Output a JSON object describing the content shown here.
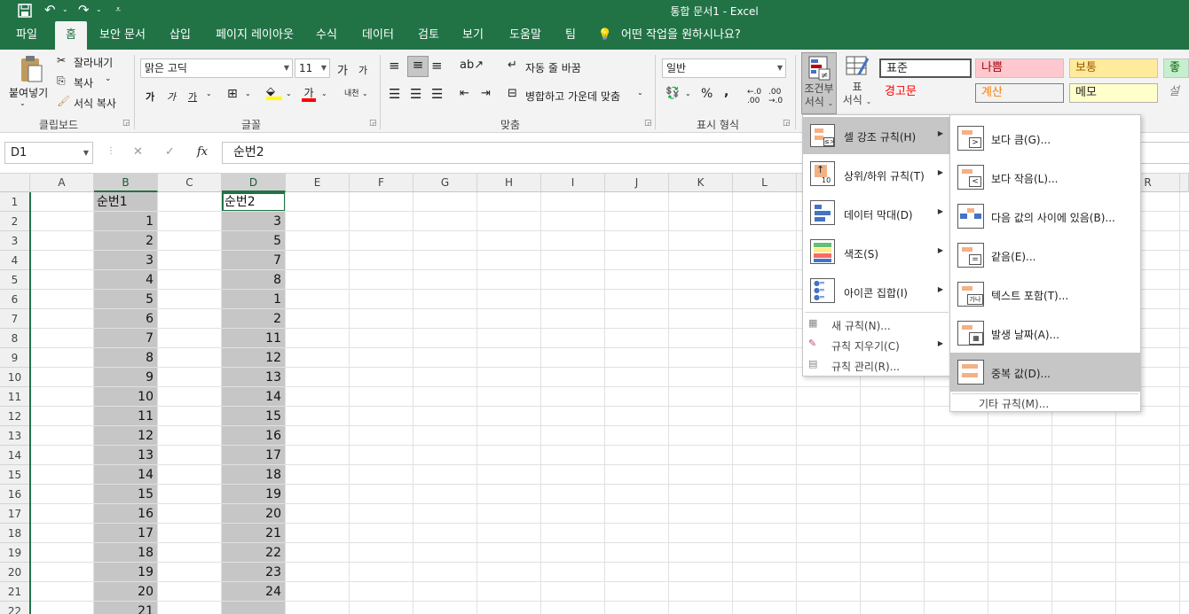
{
  "window": {
    "title": "통합 문서1  -  Excel"
  },
  "quick_access": {
    "save_icon": "save-icon",
    "undo_icon": "undo-icon",
    "redo_icon": "redo-icon",
    "customize_icon": "customize-icon"
  },
  "tabs": [
    {
      "label": "파일"
    },
    {
      "label": "홈"
    },
    {
      "label": "보안 문서"
    },
    {
      "label": "삽입"
    },
    {
      "label": "페이지 레이아웃"
    },
    {
      "label": "수식"
    },
    {
      "label": "데이터"
    },
    {
      "label": "검토"
    },
    {
      "label": "보기"
    },
    {
      "label": "도움말"
    },
    {
      "label": "팀"
    }
  ],
  "tell_me": "어떤 작업을 원하시나요?",
  "clipboard": {
    "paste": "붙여넣기",
    "cut": "잘라내기",
    "copy": "복사",
    "format_painter": "서식 복사",
    "label": "클립보드"
  },
  "font": {
    "name": "맑은 고딕",
    "size": "11",
    "grow": "가",
    "shrink": "가",
    "bold": "가",
    "italic": "가",
    "underline": "가",
    "font_color": "가",
    "phonetic": "내천",
    "label": "글꼴"
  },
  "alignment": {
    "wrap_text": "자동 줄 바꿈",
    "merge_center": "병합하고 가운데 맞춤",
    "label": "맞춤"
  },
  "number": {
    "format": "일반",
    "percent": "%",
    "comma": ",",
    "label": "표시 형식"
  },
  "styles": {
    "conditional": "조건부 서식",
    "conditional_l1": "조건부",
    "conditional_l2": "서식",
    "table_l1": "표",
    "table_l2": "서식",
    "cells": [
      {
        "label": "표준"
      },
      {
        "label": "나쁨"
      },
      {
        "label": "보통"
      },
      {
        "label": "좋음"
      },
      {
        "label": "경고문"
      },
      {
        "label": "계산"
      },
      {
        "label": "메모"
      },
      {
        "label": "설명"
      }
    ],
    "colors": {
      "bad_bg": "#ffc7ce",
      "bad_fg": "#9c0006",
      "neutral_bg": "#ffeb9c",
      "neutral_fg": "#9c5700",
      "good_bg": "#c6efce",
      "good_fg": "#006100",
      "warn_fg": "#ff0000",
      "calc_fg": "#fa7d00",
      "note_bg": "#ffffcc"
    }
  },
  "formula_bar": {
    "name_box": "D1",
    "cancel": "✕",
    "enter": "✓",
    "fx": "fx",
    "value": "순번2"
  },
  "sheet": {
    "columns": [
      "A",
      "B",
      "C",
      "D",
      "E",
      "F",
      "G",
      "H",
      "I",
      "J",
      "K",
      "L",
      "R"
    ],
    "rows": [
      "1",
      "2",
      "3",
      "4",
      "5",
      "6",
      "7",
      "8",
      "9",
      "10",
      "11",
      "12",
      "13",
      "14",
      "15",
      "16",
      "17",
      "18",
      "19",
      "20",
      "21",
      "22"
    ],
    "col_b": [
      "순번1",
      "1",
      "2",
      "3",
      "4",
      "5",
      "6",
      "7",
      "8",
      "9",
      "10",
      "11",
      "12",
      "13",
      "14",
      "15",
      "16",
      "17",
      "18",
      "19",
      "20",
      "21"
    ],
    "col_d": [
      "순번2",
      "3",
      "5",
      "7",
      "8",
      "1",
      "2",
      "11",
      "12",
      "13",
      "14",
      "15",
      "16",
      "17",
      "18",
      "19",
      "20",
      "21",
      "22",
      "23",
      "24",
      ""
    ]
  },
  "cf_menu": {
    "items": [
      {
        "label": "셀 강조 규칙(H)"
      },
      {
        "label": "상위/하위 규칙(T)"
      },
      {
        "label": "데이터 막대(D)"
      },
      {
        "label": "색조(S)"
      },
      {
        "label": "아이콘 집합(I)"
      },
      {
        "label": "새 규칙(N)..."
      },
      {
        "label": "규칙 지우기(C)"
      },
      {
        "label": "규칙 관리(R)..."
      }
    ]
  },
  "highlight_menu": {
    "items": [
      {
        "label": "보다 큼(G)..."
      },
      {
        "label": "보다 작음(L)..."
      },
      {
        "label": "다음 값의 사이에 있음(B)..."
      },
      {
        "label": "같음(E)..."
      },
      {
        "label": "텍스트 포함(T)..."
      },
      {
        "label": "발생 날짜(A)..."
      },
      {
        "label": "중복 값(D)..."
      },
      {
        "label": "기타 규칙(M)..."
      }
    ]
  },
  "accent": {
    "excel_green": "#217346",
    "selection_gray": "#c6c6c6"
  }
}
